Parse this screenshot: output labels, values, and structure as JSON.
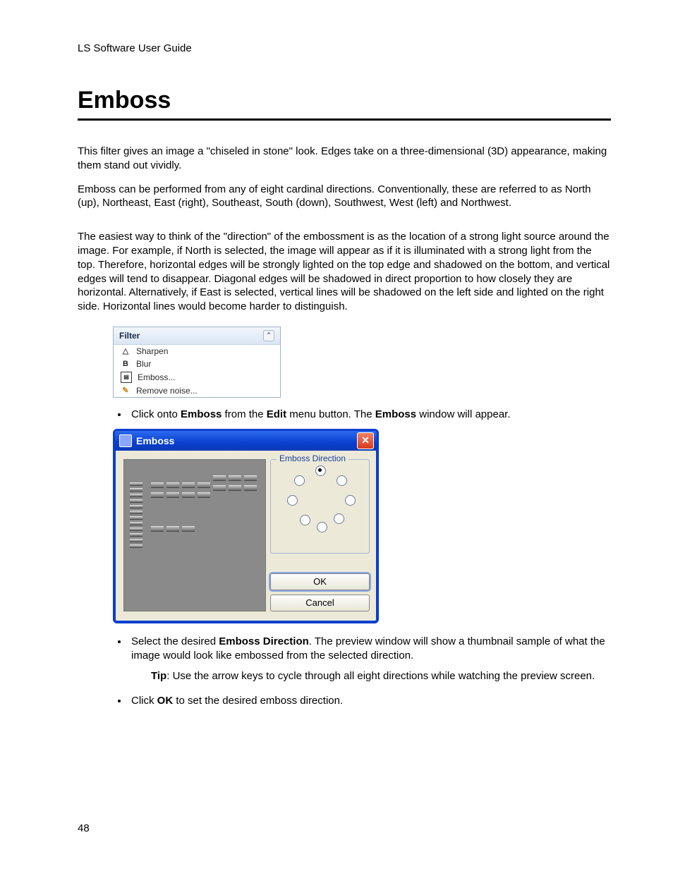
{
  "header": "LS Software User Guide",
  "title": "Emboss",
  "para1": "This filter gives an image a \"chiseled in stone\" look. Edges take on a three-dimensional (3D) appearance, making them stand out vividly.",
  "para2": "Emboss can be performed from any of eight cardinal directions. Conventionally, these are referred to as North (up), Northeast, East (right), Southeast, South (down), Southwest, West (left) and Northwest.",
  "para3": "The easiest way to think of the \"direction\" of the embossment is as the location of a strong light source around the image. For example, if North is selected, the image will appear as if it is illuminated with a strong light from the top. Therefore, horizontal edges will be strongly lighted on the top edge and shadowed on the bottom, and vertical edges will tend to disappear. Diagonal edges will be shadowed in direct proportion to how closely they are horizontal. Alternatively, if East is selected, vertical lines will be shadowed on the left side and lighted on the right side. Horizontal lines would become harder to distinguish.",
  "filter_panel": {
    "title": "Filter",
    "items": [
      "Sharpen",
      "Blur",
      "Emboss...",
      "Remove noise..."
    ]
  },
  "bullet1": {
    "pre": "Click onto ",
    "b1": "Emboss",
    "mid1": " from the ",
    "b2": "Edit",
    "mid2": " menu button. The ",
    "b3": "Emboss",
    "post": " window will appear."
  },
  "dialog": {
    "title": "Emboss",
    "group_label": "Emboss Direction",
    "ok": "OK",
    "cancel": "Cancel",
    "selected_direction": "N"
  },
  "bullet2": {
    "pre": "Select the desired ",
    "b1": "Emboss Direction",
    "post": ". The preview window will show a thumbnail sample of what the image would look like embossed from the selected direction."
  },
  "tip": {
    "label": "Tip",
    "text": ":   Use the arrow keys to cycle through all eight directions while watching the preview screen."
  },
  "bullet3": {
    "pre": "Click ",
    "b1": "OK",
    "post": " to set the desired emboss direction."
  },
  "page_number": "48"
}
